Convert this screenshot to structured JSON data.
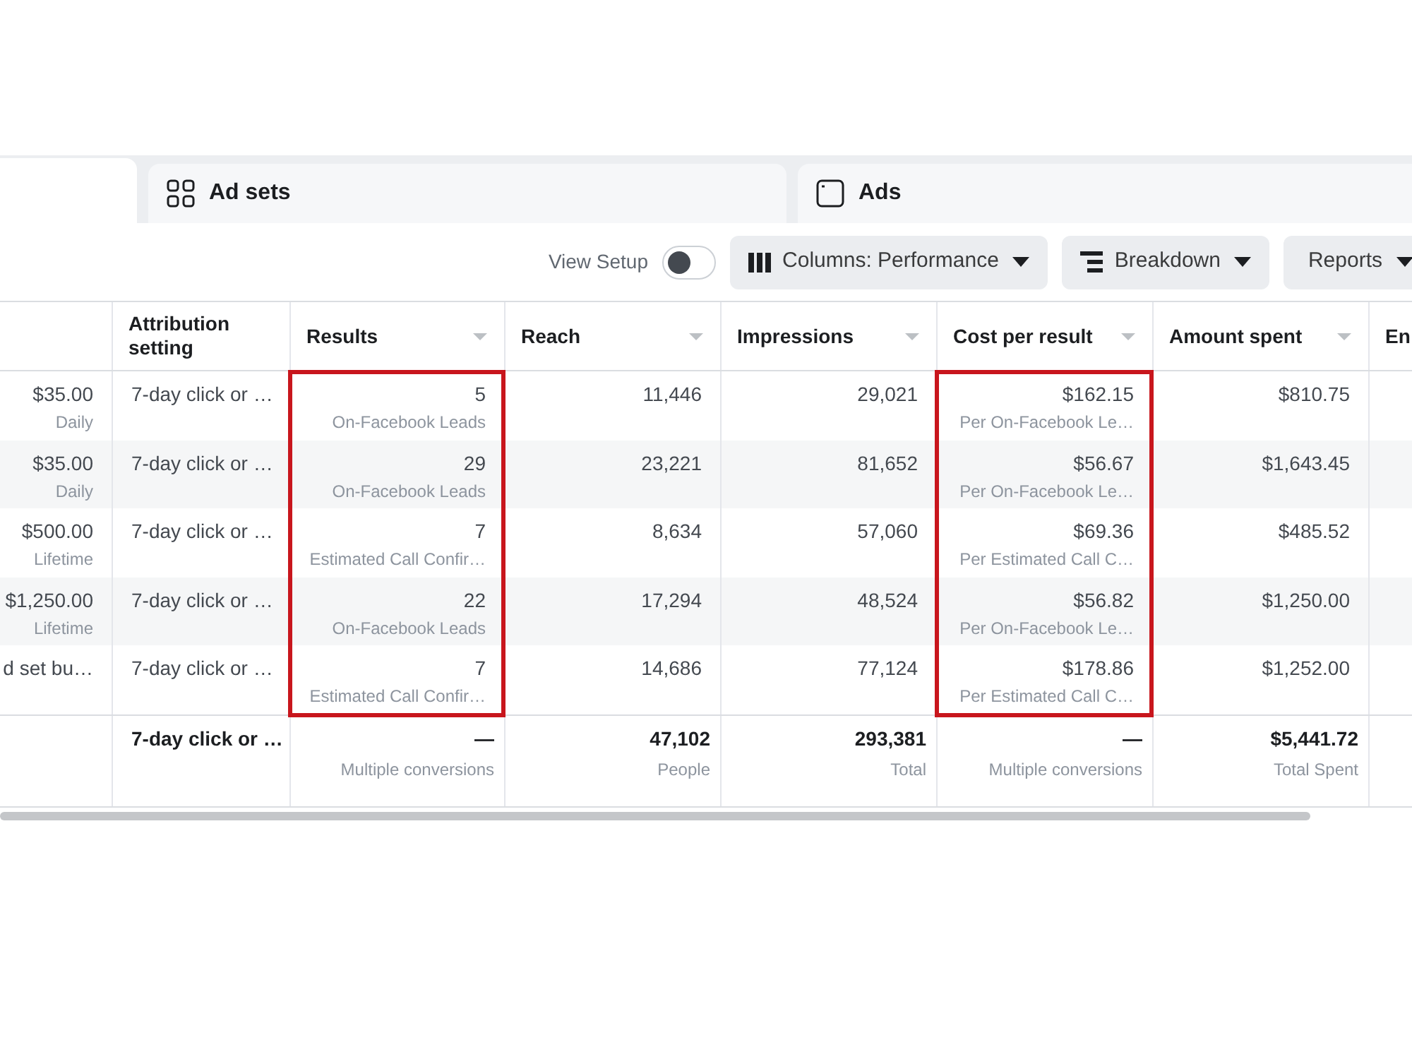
{
  "tabs": [
    {
      "kind": "blank",
      "selected": true
    },
    {
      "kind": "grid",
      "label": "Ad sets",
      "selected": false
    },
    {
      "kind": "panel",
      "label": "Ads",
      "selected": false
    }
  ],
  "toolbar": {
    "view_setup": {
      "label": "View Setup",
      "on": false
    },
    "buttons": [
      {
        "kind": "columns",
        "label": "Columns: Performance"
      },
      {
        "kind": "breakdown",
        "label": "Breakdown"
      },
      {
        "kind": "reports",
        "label": "Reports"
      }
    ]
  },
  "table": {
    "columns": [
      {
        "kind": "number",
        "highlighted": false
      },
      {
        "kind": "text",
        "label": "Attribution setting",
        "sortable": false,
        "highlighted": false
      },
      {
        "kind": "number",
        "label": "Results",
        "sortable": true,
        "highlighted": true
      },
      {
        "kind": "number",
        "label": "Reach",
        "sortable": true,
        "highlighted": false
      },
      {
        "kind": "number",
        "label": "Impressions",
        "sortable": true,
        "highlighted": false
      },
      {
        "kind": "number",
        "label": "Cost per result",
        "sortable": true,
        "highlighted": true
      },
      {
        "kind": "number",
        "label": "Amount spent",
        "sortable": true,
        "highlighted": false
      },
      {
        "kind": "text",
        "label": "En",
        "sortable": false,
        "highlighted": false
      }
    ],
    "rows": [
      {
        "cells": [
          {
            "value": "$35.00",
            "note": "Daily"
          },
          {
            "value": "7-day click or …"
          },
          {
            "value": "5",
            "note": "On-Facebook Leads"
          },
          {
            "value": "11,446"
          },
          {
            "value": "29,021"
          },
          {
            "value": "$162.15",
            "note": "Per On-Facebook Le…"
          },
          {
            "value": "$810.75"
          }
        ]
      },
      {
        "cells": [
          {
            "value": "$35.00",
            "note": "Daily"
          },
          {
            "value": "7-day click or …"
          },
          {
            "value": "29",
            "note": "On-Facebook Leads"
          },
          {
            "value": "23,221"
          },
          {
            "value": "81,652"
          },
          {
            "value": "$56.67",
            "note": "Per On-Facebook Le…"
          },
          {
            "value": "$1,643.45"
          }
        ]
      },
      {
        "cells": [
          {
            "value": "$500.00",
            "note": "Lifetime"
          },
          {
            "value": "7-day click or …"
          },
          {
            "value": "7",
            "note": "Estimated Call Confir…"
          },
          {
            "value": "8,634"
          },
          {
            "value": "57,060"
          },
          {
            "value": "$69.36",
            "note": "Per Estimated Call C…"
          },
          {
            "value": "$485.52"
          }
        ]
      },
      {
        "cells": [
          {
            "value": "$1,250.00",
            "note": "Lifetime"
          },
          {
            "value": "7-day click or …"
          },
          {
            "value": "22",
            "note": "On-Facebook Leads"
          },
          {
            "value": "17,294"
          },
          {
            "value": "48,524"
          },
          {
            "value": "$56.82",
            "note": "Per On-Facebook Le…"
          },
          {
            "value": "$1,250.00"
          }
        ]
      },
      {
        "cells": [
          {
            "value": "d set bu…"
          },
          {
            "value": "7-day click or …"
          },
          {
            "value": "7",
            "note": "Estimated Call Confir…"
          },
          {
            "value": "14,686"
          },
          {
            "value": "77,124"
          },
          {
            "value": "$178.86",
            "note": "Per Estimated Call C…"
          },
          {
            "value": "$1,252.00"
          }
        ]
      }
    ],
    "summary": {
      "cells": [
        {},
        {
          "value": "7-day click or …"
        },
        {
          "value": "—",
          "note": "Multiple conversions"
        },
        {
          "value": "47,102",
          "note": "People"
        },
        {
          "value": "293,381",
          "note": "Total"
        },
        {
          "value": "—",
          "note": "Multiple conversions"
        },
        {
          "value": "$5,441.72",
          "note": "Total Spent"
        }
      ]
    }
  }
}
